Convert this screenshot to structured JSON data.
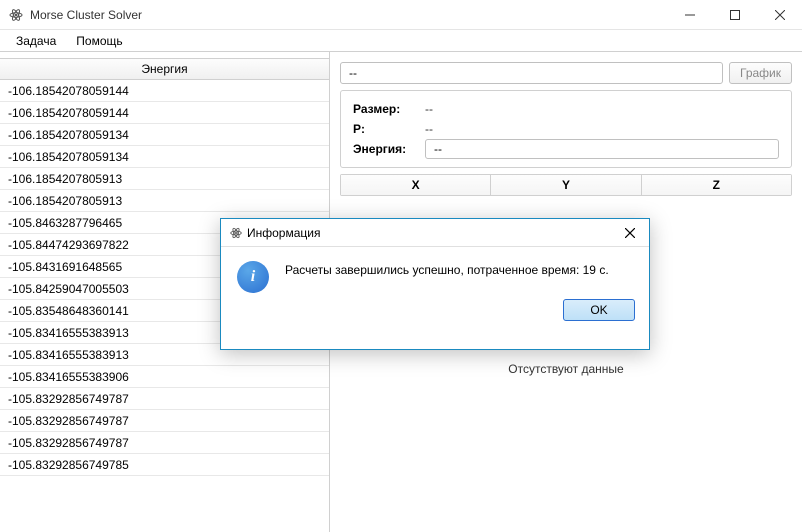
{
  "window": {
    "title": "Morse Cluster Solver"
  },
  "menu": {
    "task": "Задача",
    "help": "Помощь"
  },
  "left": {
    "header": "Энергия",
    "rows": [
      "-106.18542078059144",
      "-106.18542078059144",
      "-106.18542078059134",
      "-106.18542078059134",
      "-106.1854207805913",
      "-106.1854207805913",
      "-105.8463287796465",
      "-105.84474293697822",
      "-105.8431691648565",
      "-105.84259047005503",
      "-105.83548648360141",
      "-105.83416555383913",
      "-105.83416555383913",
      "-105.83416555383906",
      "-105.83292856749787",
      "-105.83292856749787",
      "-105.83292856749787",
      "-105.83292856749785"
    ]
  },
  "right": {
    "search_value": "--",
    "graph_btn": "График",
    "size_label": "Размер:",
    "size_value": "--",
    "p_label": "P:",
    "p_value": "--",
    "energy_label": "Энергия:",
    "energy_value": "--",
    "col_x": "X",
    "col_y": "Y",
    "col_z": "Z",
    "no_data": "Отсутствуют данные"
  },
  "dialog": {
    "title": "Информация",
    "message": "Расчеты завершились успешно, потраченное время: 19 с.",
    "ok": "OK"
  }
}
